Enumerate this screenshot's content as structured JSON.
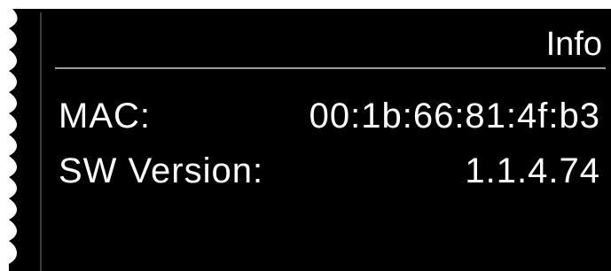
{
  "screen": {
    "title": "Info",
    "background_color": "#000000",
    "text_color": "#ffffff",
    "divider_color": "#9a9a9a"
  },
  "rows": [
    {
      "label": "MAC:",
      "value": "00:1b:66:81:4f:b3"
    },
    {
      "label": "SW Version:",
      "value": "1.1.4.74"
    }
  ]
}
